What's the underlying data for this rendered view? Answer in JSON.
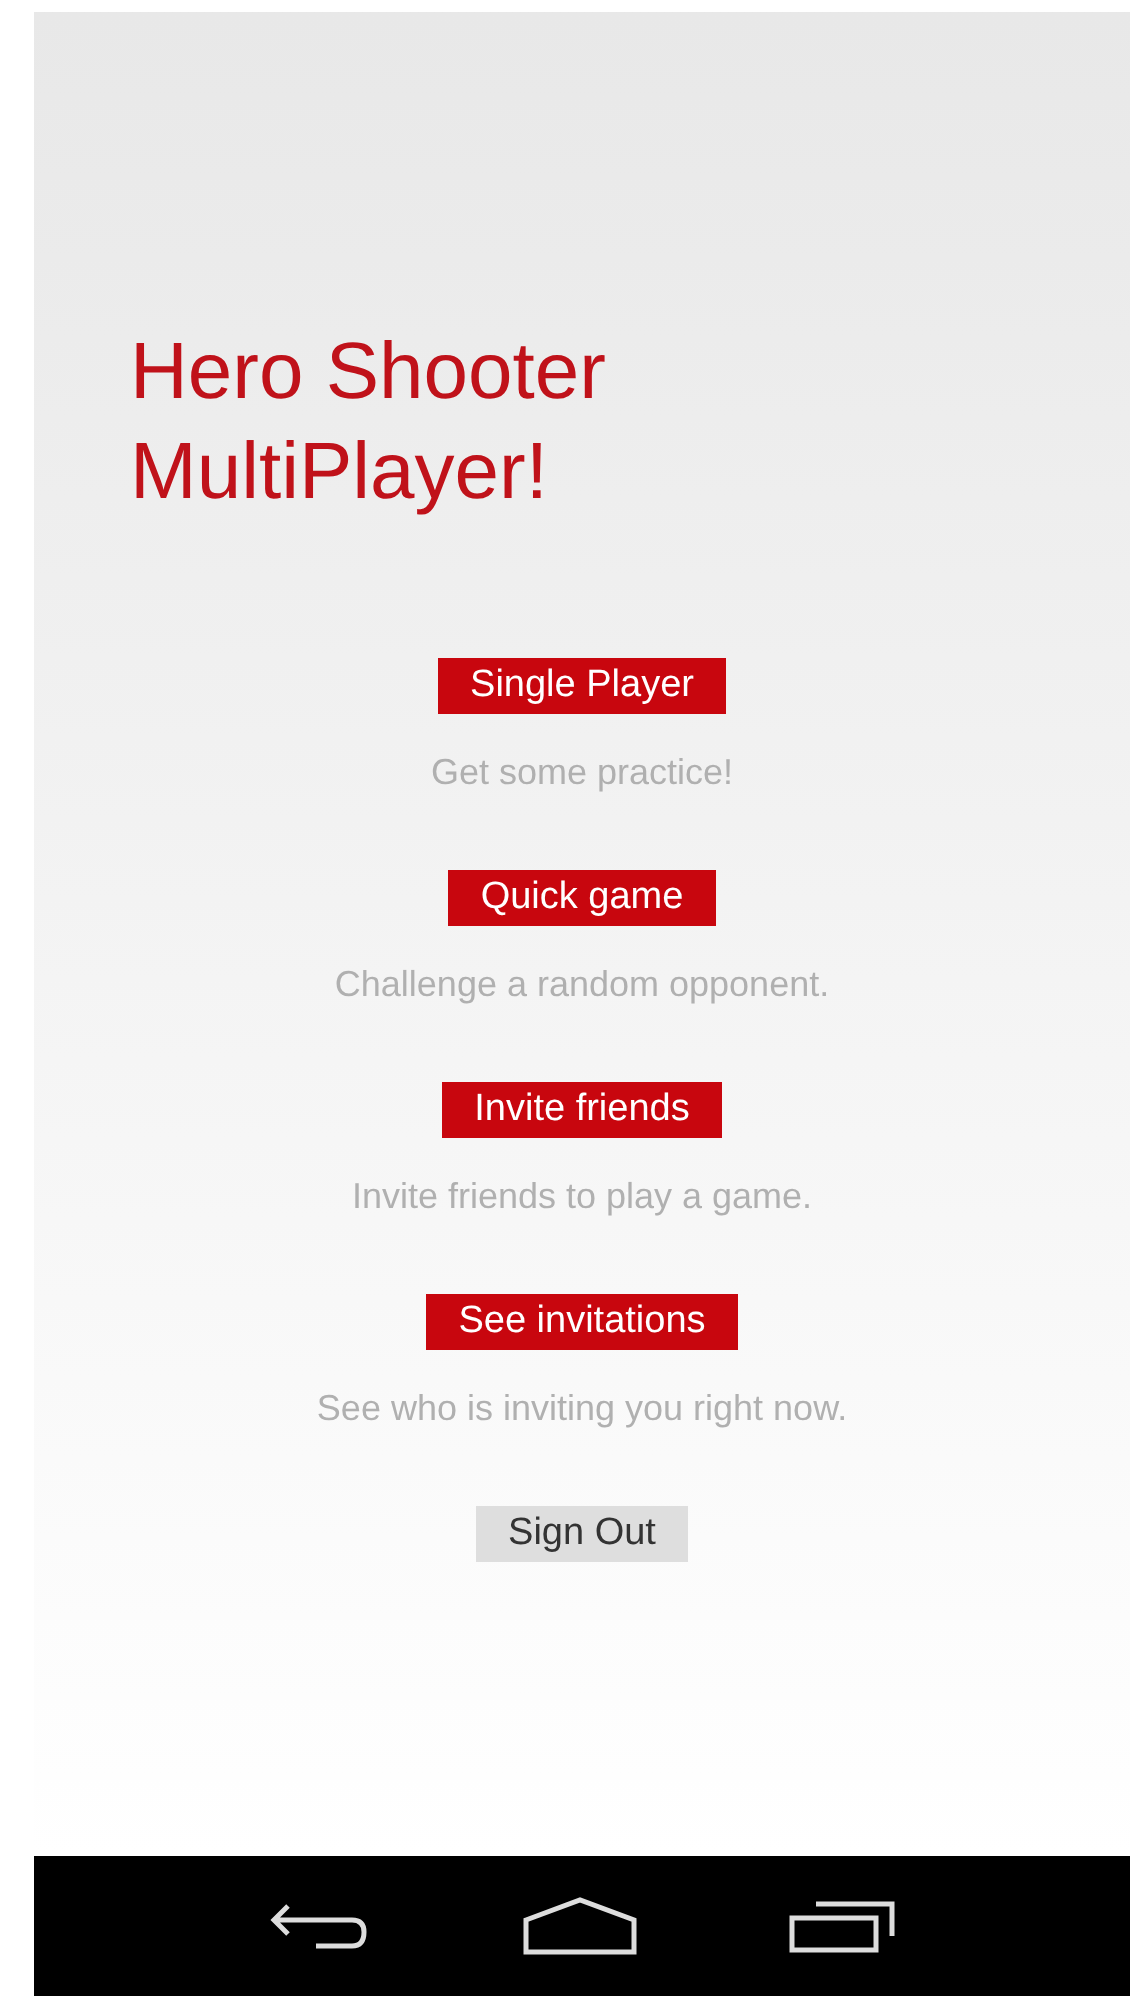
{
  "title": "Hero Shooter MultiPlayer!",
  "menu": [
    {
      "kind": "primary",
      "label": "Single Player",
      "description": "Get some practice!"
    },
    {
      "kind": "primary",
      "label": "Quick game",
      "description": "Challenge a random opponent."
    },
    {
      "kind": "primary",
      "label": "Invite friends",
      "description": "Invite friends to play a game."
    },
    {
      "kind": "primary",
      "label": "See invitations",
      "description": "See who is inviting you right now."
    },
    {
      "kind": "secondary",
      "label": "Sign Out"
    }
  ]
}
